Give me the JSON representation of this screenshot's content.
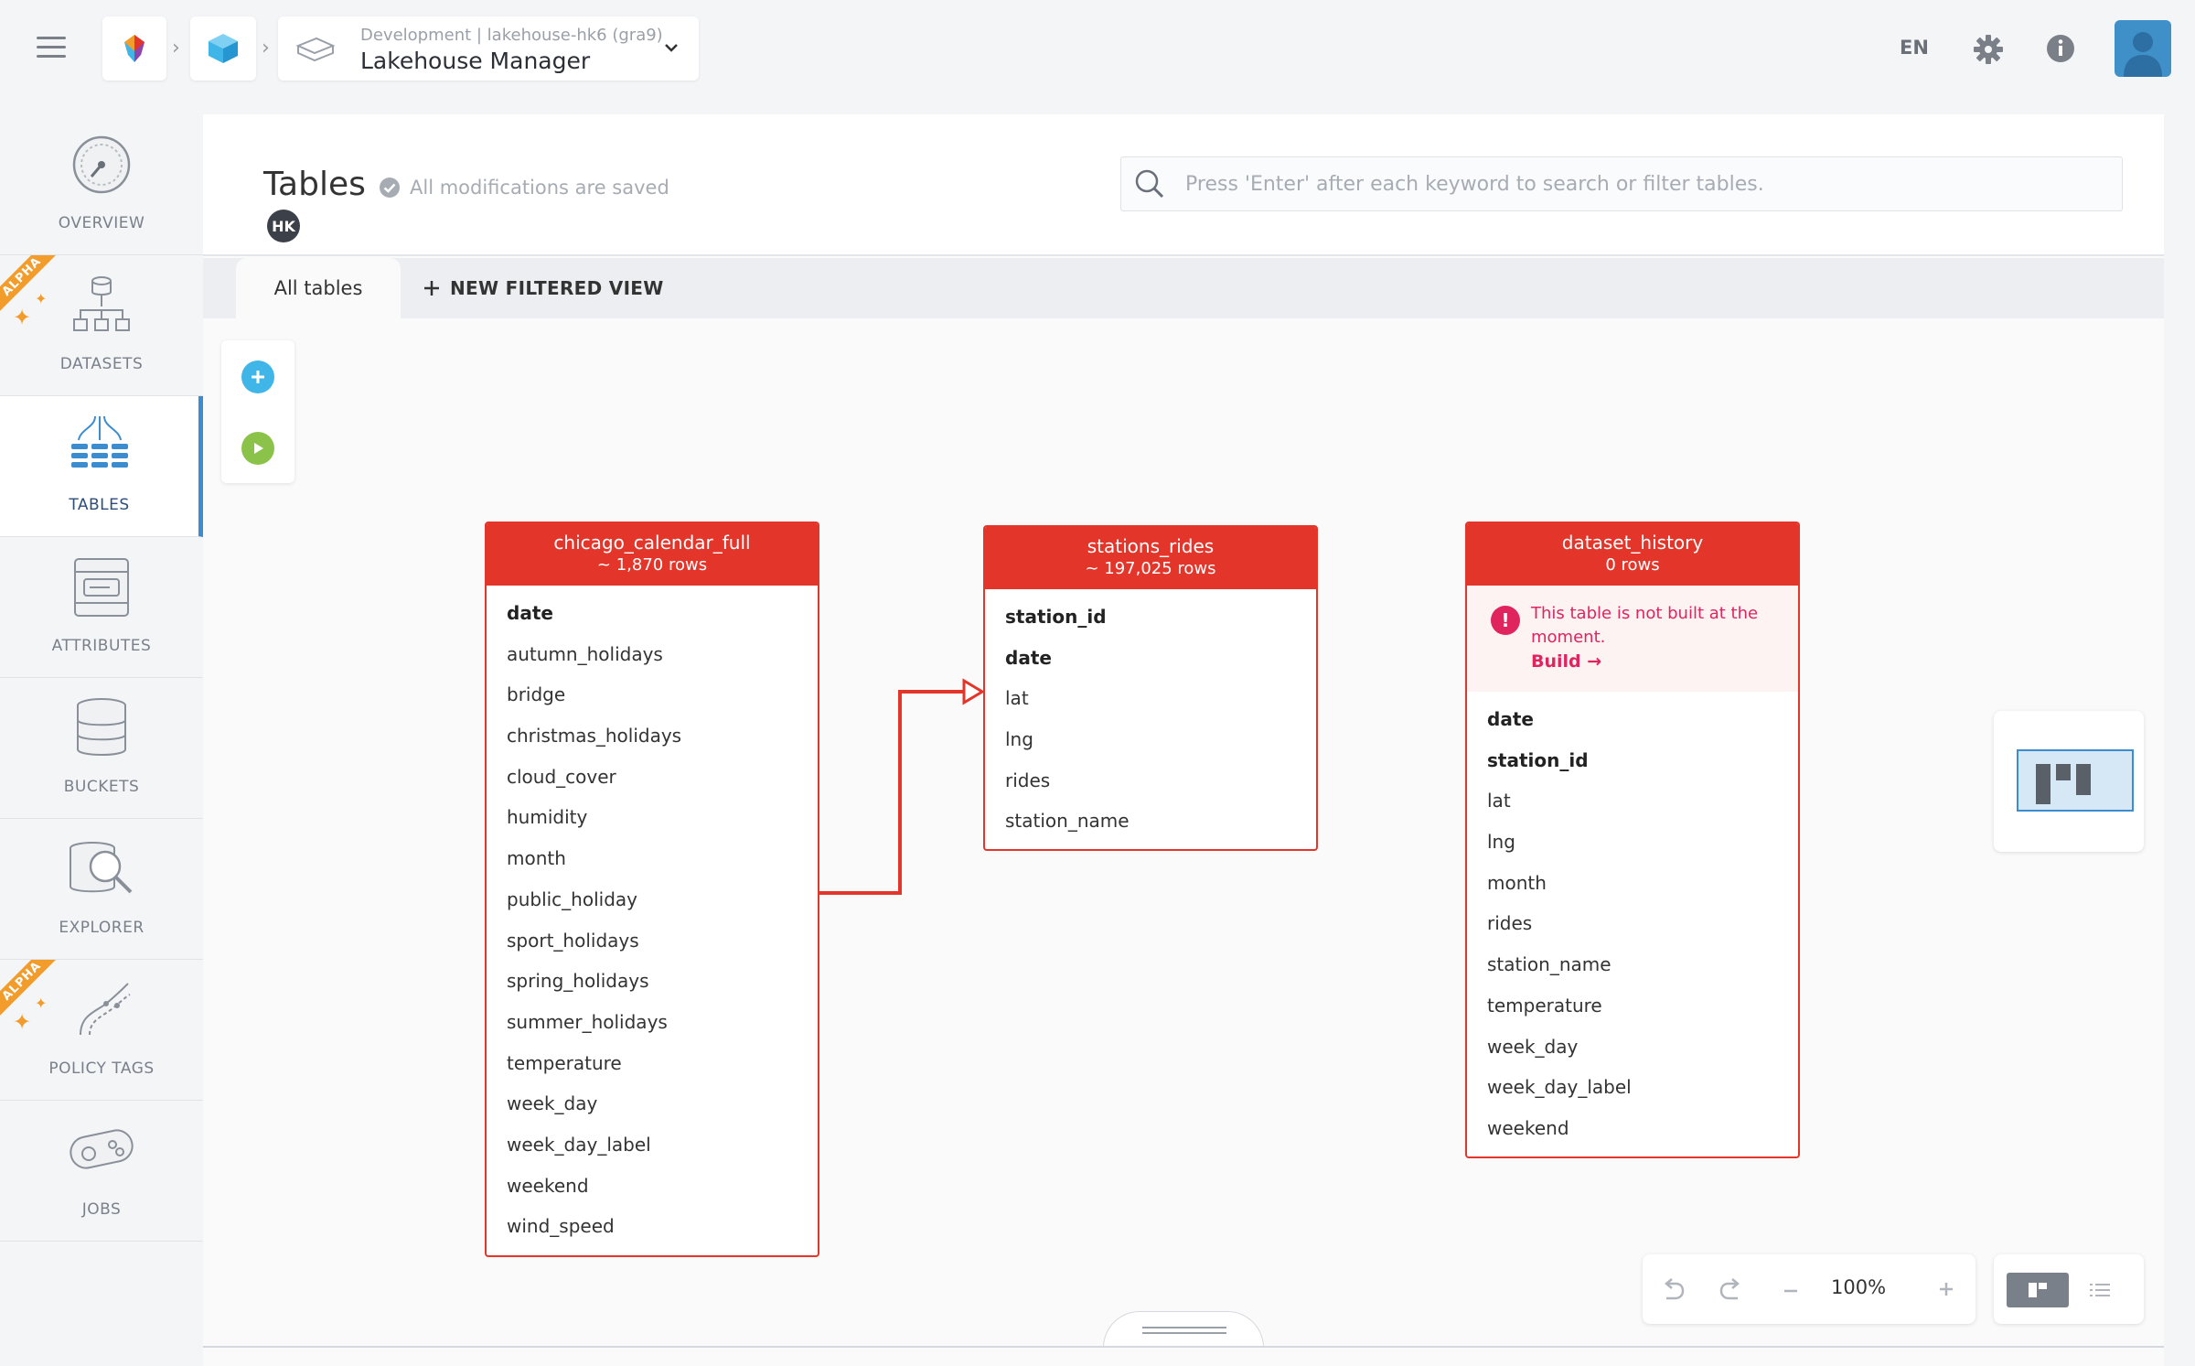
{
  "header": {
    "project_subtitle": "Development | lakehouse-hk6 (gra9)",
    "project_title": "Lakehouse Manager",
    "language": "EN"
  },
  "sidebar": {
    "items": [
      {
        "label": "OVERVIEW",
        "alpha": false,
        "icon": "gauge-icon"
      },
      {
        "label": "DATASETS",
        "alpha": true,
        "icon": "datasets-icon"
      },
      {
        "label": "TABLES",
        "alpha": false,
        "icon": "tables-icon",
        "active": true
      },
      {
        "label": "ATTRIBUTES",
        "alpha": false,
        "icon": "attributes-icon"
      },
      {
        "label": "BUCKETS",
        "alpha": false,
        "icon": "buckets-icon"
      },
      {
        "label": "EXPLORER",
        "alpha": false,
        "icon": "explorer-icon"
      },
      {
        "label": "POLICY TAGS",
        "alpha": true,
        "icon": "policy-tags-icon"
      },
      {
        "label": "JOBS",
        "alpha": false,
        "icon": "jobs-icon"
      }
    ],
    "alpha_label": "ALPHA"
  },
  "page": {
    "title": "Tables",
    "saved_status": "All modifications are saved",
    "owner_badge": "HK",
    "search_placeholder": "Press 'Enter' after each keyword to search or filter tables."
  },
  "tabs": {
    "all_tables": "All tables",
    "new_filtered_view": "NEW FILTERED VIEW"
  },
  "tables": [
    {
      "name": "chicago_calendar_full",
      "rows": "~ 1,870 rows",
      "columns": [
        {
          "name": "date",
          "key": true
        },
        {
          "name": "autumn_holidays",
          "key": false
        },
        {
          "name": "bridge",
          "key": false
        },
        {
          "name": "christmas_holidays",
          "key": false
        },
        {
          "name": "cloud_cover",
          "key": false
        },
        {
          "name": "humidity",
          "key": false
        },
        {
          "name": "month",
          "key": false
        },
        {
          "name": "public_holiday",
          "key": false
        },
        {
          "name": "sport_holidays",
          "key": false
        },
        {
          "name": "spring_holidays",
          "key": false
        },
        {
          "name": "summer_holidays",
          "key": false
        },
        {
          "name": "temperature",
          "key": false
        },
        {
          "name": "week_day",
          "key": false
        },
        {
          "name": "week_day_label",
          "key": false
        },
        {
          "name": "weekend",
          "key": false
        },
        {
          "name": "wind_speed",
          "key": false
        }
      ]
    },
    {
      "name": "stations_rides",
      "rows": "~ 197,025 rows",
      "columns": [
        {
          "name": "station_id",
          "key": true
        },
        {
          "name": "date",
          "key": true
        },
        {
          "name": "lat",
          "key": false
        },
        {
          "name": "lng",
          "key": false
        },
        {
          "name": "rides",
          "key": false
        },
        {
          "name": "station_name",
          "key": false
        }
      ]
    },
    {
      "name": "dataset_history",
      "rows": "0 rows",
      "warning": "This table is not built at the moment.",
      "build_label": "Build",
      "columns": [
        {
          "name": "date",
          "key": true
        },
        {
          "name": "station_id",
          "key": true
        },
        {
          "name": "lat",
          "key": false
        },
        {
          "name": "lng",
          "key": false
        },
        {
          "name": "month",
          "key": false
        },
        {
          "name": "rides",
          "key": false
        },
        {
          "name": "station_name",
          "key": false
        },
        {
          "name": "temperature",
          "key": false
        },
        {
          "name": "week_day",
          "key": false
        },
        {
          "name": "week_day_label",
          "key": false
        },
        {
          "name": "weekend",
          "key": false
        }
      ]
    }
  ],
  "zoom": {
    "level": "100%"
  },
  "colors": {
    "table_accent": "#e4352a",
    "active_nav": "#3c8dcf",
    "warning": "#e0245e",
    "add_button": "#3fb5e8",
    "run_button": "#8bc34a"
  }
}
